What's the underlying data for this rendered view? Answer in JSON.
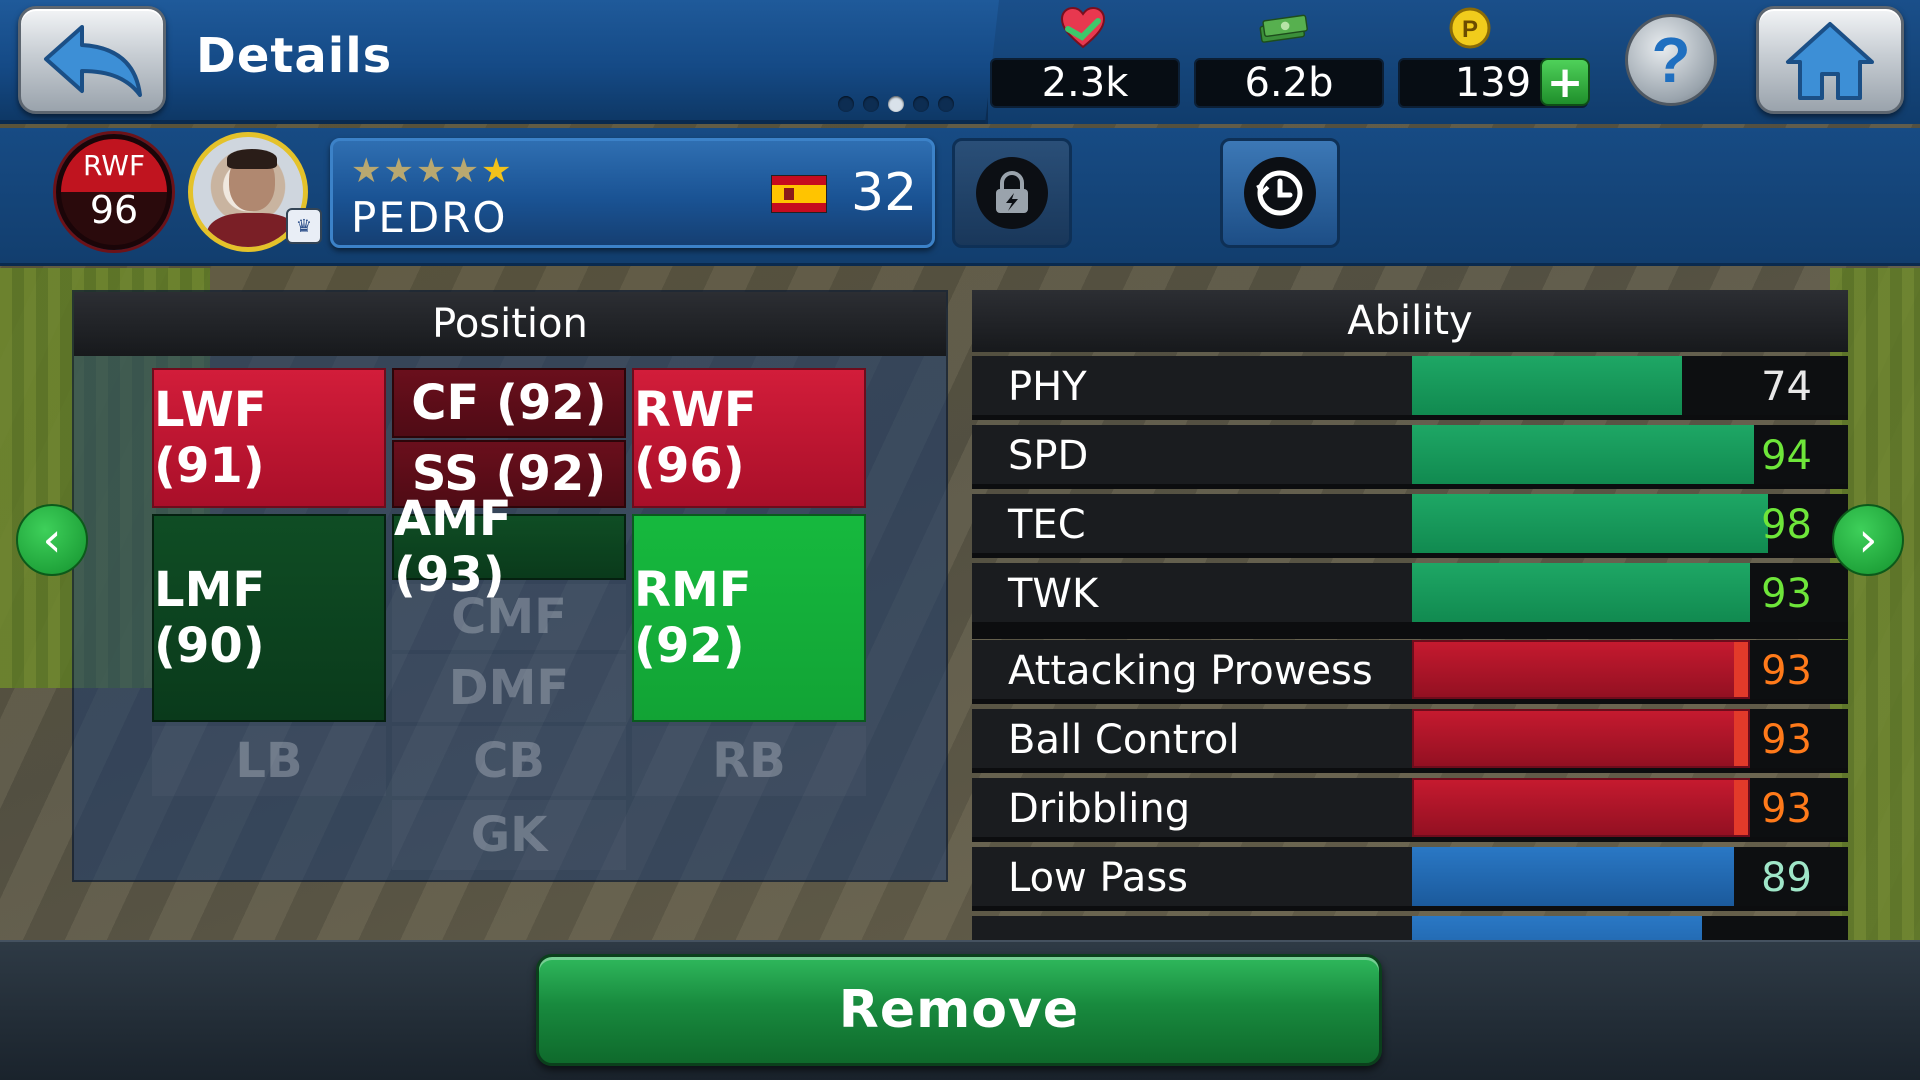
{
  "header": {
    "title": "Details",
    "page_dots": [
      false,
      false,
      true,
      false,
      false
    ],
    "currencies": {
      "gp": "2.3k",
      "money": "6.2b",
      "coins": "139"
    }
  },
  "player": {
    "position": "RWF",
    "rating": "96",
    "name": "PEDRO",
    "stars": 5,
    "age": "32"
  },
  "position_panel": {
    "header": "Position",
    "cells": {
      "lwf": "LWF (91)",
      "cf": "CF (92)",
      "ss": "SS (92)",
      "rwf": "RWF (96)",
      "amf": "AMF (93)",
      "lmf": "LMF (90)",
      "rmf": "RMF (92)",
      "cmf": "CMF",
      "dmf": "DMF",
      "lb": "LB",
      "cb": "CB",
      "rb": "RB",
      "gk": "GK"
    }
  },
  "ability_panel": {
    "header": "Ability",
    "core": [
      {
        "label": "PHY",
        "value": "74",
        "value_color": "#e8e8e8"
      },
      {
        "label": "SPD",
        "value": "94",
        "value_color": "#6ee63a"
      },
      {
        "label": "TEC",
        "value": "98",
        "value_color": "#6ee63a"
      },
      {
        "label": "TWK",
        "value": "93",
        "value_color": "#6ee63a"
      }
    ],
    "skills": [
      {
        "label": "Attacking Prowess",
        "value": "93",
        "value_color": "#ff7a1a"
      },
      {
        "label": "Ball Control",
        "value": "93",
        "value_color": "#ff7a1a"
      },
      {
        "label": "Dribbling",
        "value": "93",
        "value_color": "#ff7a1a"
      },
      {
        "label": "Low Pass",
        "value": "89",
        "value_color": "#9fe6c8"
      }
    ]
  },
  "actions": {
    "remove": "Remove"
  },
  "colors": {
    "accent_blue": "#1f5a9a",
    "bar_green": "#1ea765",
    "bar_red": "#c51a2f",
    "bar_blue": "#2a78c5",
    "remove_green": "#188a3e"
  }
}
